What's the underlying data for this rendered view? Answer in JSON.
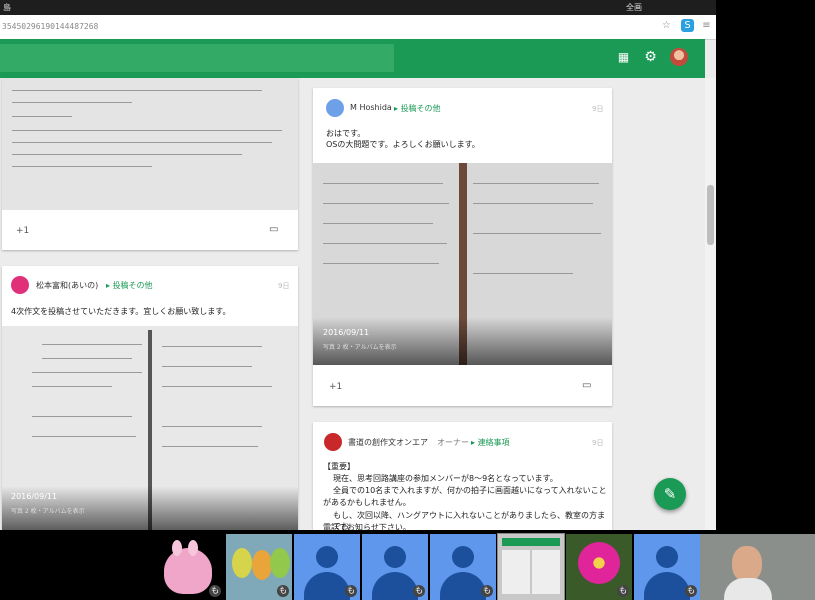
{
  "titlebar": {
    "left": "島",
    "right": "全画"
  },
  "address_bar": {
    "url": "35450296190144487268"
  },
  "header": {
    "search_text": ""
  },
  "posts": [
    {
      "author": "",
      "category": "",
      "date": "",
      "text": "",
      "plus_one": "+1"
    },
    {
      "author": "M Hoshida",
      "category": "投稿その他",
      "date": "9日",
      "text_lines": [
        "おはです。",
        "OSの大問題です。よろしくお願いします。"
      ],
      "photo_date": "2016/09/11",
      "photo_caption": "写真 2 枚・アルバムを表示",
      "plus_one": "+1"
    },
    {
      "author": "松本富和(あいの)",
      "category": "投稿その他",
      "date": "9日",
      "text_lines": [
        "4次作文を投稿させていただきます。宜しくお願い致します。"
      ],
      "photo_date": "2016/09/11",
      "photo_caption": "写真 2 枚・アルバムを表示"
    },
    {
      "author": "書道の創作文オンエア",
      "role": "オーナー",
      "category": "連絡事項",
      "date": "9日",
      "text_lines": [
        "【重要】",
        "現在、思考回路講座の参加メンバーが8～9名となっています。",
        "全員での10名まで入れますが、何かの拍子に画面越いになって入れないこと",
        "があるかもしれません。",
        "もし、次回以降、ハングアウトに入れないことがありましたら、教室の方までお",
        "電話でお知らせ下さい。"
      ]
    }
  ],
  "participants": [
    {
      "name": "pink-character",
      "mic": "も"
    },
    {
      "name": "birds",
      "mic": "も"
    },
    {
      "name": "blue-avatar",
      "mic": "も"
    },
    {
      "name": "blue-avatar",
      "mic": "も"
    },
    {
      "name": "blue-avatar",
      "mic": "も"
    },
    {
      "name": "screen-share",
      "mic": ""
    },
    {
      "name": "flower",
      "mic": "も"
    },
    {
      "name": "blue-avatar",
      "mic": "も"
    },
    {
      "name": "camera-man",
      "mic": ""
    }
  ],
  "colors": {
    "accent": "#1a9a55",
    "participant_blue": "#5e97ec"
  }
}
